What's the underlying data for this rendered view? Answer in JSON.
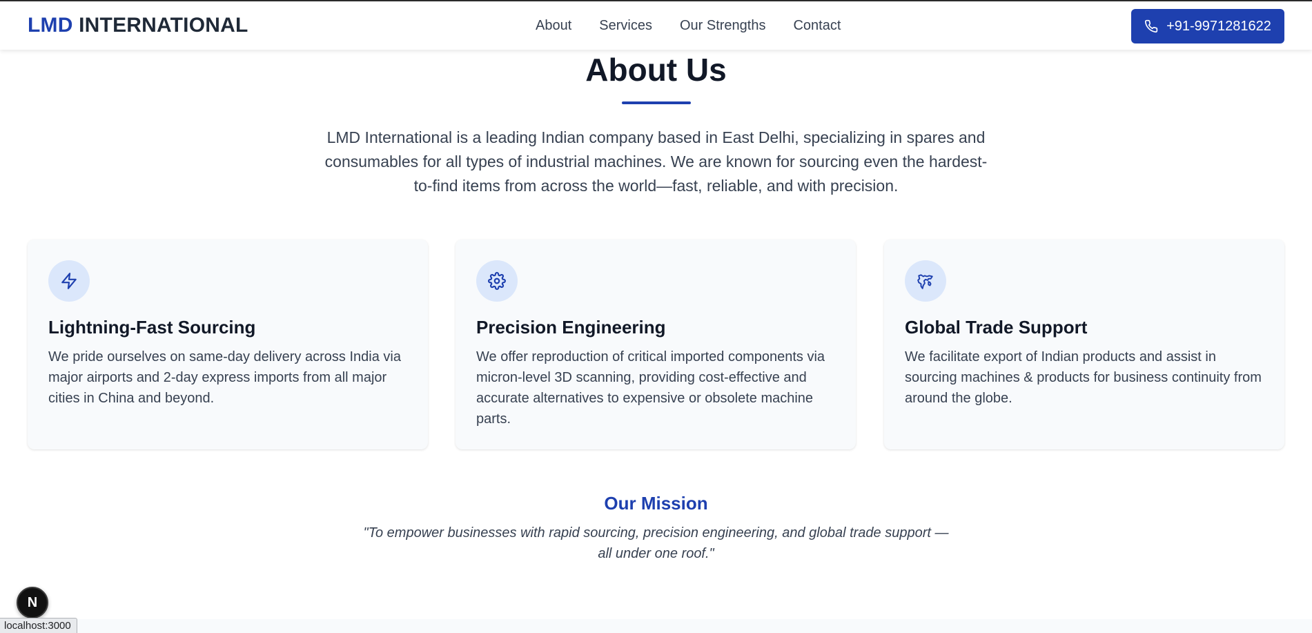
{
  "header": {
    "logo_brand": "LMD",
    "logo_rest": "INTERNATIONAL",
    "nav": [
      {
        "label": "About"
      },
      {
        "label": "Services"
      },
      {
        "label": "Our Strengths"
      },
      {
        "label": "Contact"
      }
    ],
    "phone_label": "+91-9971281622"
  },
  "about": {
    "title": "About Us",
    "description": "LMD International is a leading Indian company based in East Delhi, specializing in spares and consumables for all types of industrial machines. We are known for sourcing even the hardest-to-find items from across the world—fast, reliable, and with precision."
  },
  "features": [
    {
      "icon": "lightning-icon",
      "title": "Lightning-Fast Sourcing",
      "text": "We pride ourselves on same-day delivery across India via major airports and 2-day express imports from all major cities in China and beyond."
    },
    {
      "icon": "gear-icon",
      "title": "Precision Engineering",
      "text": "We offer reproduction of critical imported components via micron-level 3D scanning, providing cost-effective and accurate alternatives to expensive or obsolete machine parts."
    },
    {
      "icon": "world-map-icon",
      "title": "Global Trade Support",
      "text": "We facilitate export of Indian products and assist in sourcing machines & products for business continuity from around the globe."
    }
  ],
  "mission": {
    "title": "Our Mission",
    "quote": "\"To empower businesses with rapid sourcing, precision engineering, and global trade support —all under one roof.\""
  },
  "dev": {
    "badge_letter": "N",
    "status_url": "localhost:3000"
  },
  "colors": {
    "accent": "#1e40af",
    "card_background": "#f8fafc",
    "icon_circle": "#dbe7fb"
  }
}
